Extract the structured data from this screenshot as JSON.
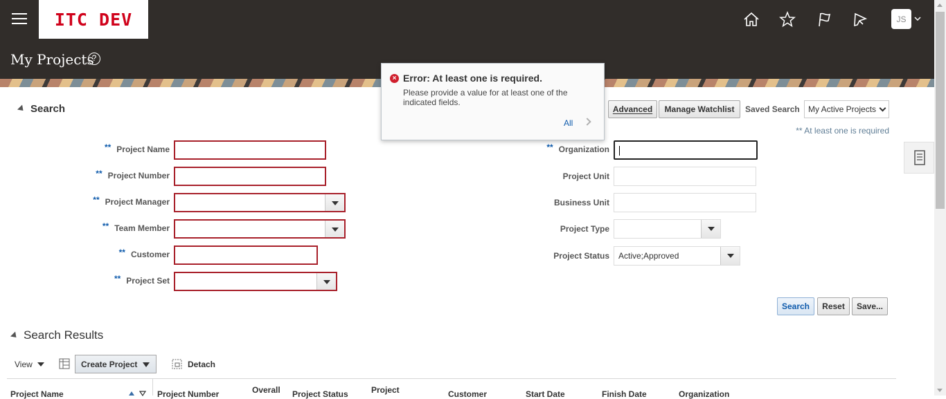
{
  "header": {
    "logo_text": "ITC DEV",
    "user_initials": "JS",
    "icons": [
      "hamburger-menu-icon",
      "home-icon",
      "favorites-star-icon",
      "flag-icon",
      "notifications-icon"
    ]
  },
  "page": {
    "title": "My Projects"
  },
  "search": {
    "title": "Search",
    "advanced_label": "Advanced",
    "watchlist_label": "Manage Watchlist",
    "saved_search_label": "Saved Search",
    "saved_search_value": "My Active Projects",
    "required_note": "** At least one is required",
    "required_marker": "**",
    "fields_left": [
      {
        "label": "Project Name",
        "value": ""
      },
      {
        "label": "Project Number",
        "value": ""
      },
      {
        "label": "Project Manager",
        "value": ""
      },
      {
        "label": "Team Member",
        "value": ""
      },
      {
        "label": "Customer",
        "value": ""
      },
      {
        "label": "Project Set",
        "value": ""
      }
    ],
    "fields_right": [
      {
        "label": "Organization",
        "value": ""
      },
      {
        "label": "Project Unit",
        "value": ""
      },
      {
        "label": "Business Unit",
        "value": ""
      },
      {
        "label": "Project Type",
        "value": ""
      },
      {
        "label": "Project Status",
        "value": "Active;Approved"
      }
    ],
    "search_btn": "Search",
    "reset_btn": "Reset",
    "save_btn": "Save..."
  },
  "error_popup": {
    "title": "Error: At least one is required.",
    "message": "Please provide a value for at least one of the indicated fields.",
    "link": "All"
  },
  "results": {
    "title": "Search Results",
    "view_label": "View",
    "create_label": "Create Project",
    "detach_label": "Detach",
    "columns": [
      "Project Name",
      "Project Number",
      "Overall",
      "Project Status",
      "Project",
      "Customer",
      "Start Date",
      "Finish Date",
      "Organization"
    ]
  }
}
